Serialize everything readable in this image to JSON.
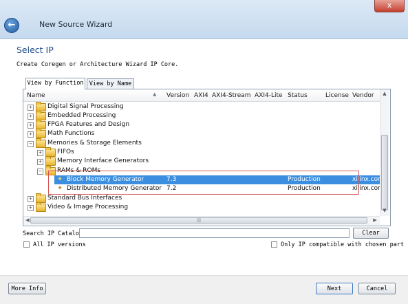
{
  "window": {
    "title": "New Source Wizard",
    "close_label": "x",
    "back_label": "←"
  },
  "page": {
    "heading": "Select IP",
    "instruction": "Create Coregen or Architecture Wizard IP Core."
  },
  "tabs": [
    {
      "label": "View by Function",
      "active": true
    },
    {
      "label": "View by Name",
      "active": false
    }
  ],
  "columns": [
    "Name",
    "Version",
    "AXI4",
    "AXI4-Stream",
    "AXI4-Lite",
    "Status",
    "License",
    "Vendor"
  ],
  "tree": [
    {
      "label": "Digital Signal Processing",
      "expander": "+"
    },
    {
      "label": "Embedded Processing",
      "expander": "+"
    },
    {
      "label": "FPGA Features and Design",
      "expander": "+"
    },
    {
      "label": "Math Functions",
      "expander": "+"
    },
    {
      "label": "Memories & Storage Elements",
      "expander": "−"
    },
    {
      "label": "FIFOs",
      "expander": "+"
    },
    {
      "label": "Memory Interface Generators",
      "expander": "+"
    },
    {
      "label": "RAMs & ROMs",
      "expander": "−"
    },
    {
      "label": "Block Memory Generator",
      "version": "7.3",
      "status": "Production",
      "vendor": "xilinx.com",
      "selected": true
    },
    {
      "label": "Distributed Memory Generator",
      "version": "7.2",
      "status": "Production",
      "vendor": "xilinx.com"
    },
    {
      "label": "Standard Bus Interfaces",
      "expander": "+"
    },
    {
      "label": "Video & Image Processing",
      "expander": "+"
    }
  ],
  "scroll": {
    "up": "▲",
    "down": "▼",
    "left": "◀",
    "right": "▶",
    "grip": "|||"
  },
  "search": {
    "label": "Search IP Catalog:",
    "value": "",
    "clear_label": "Clear"
  },
  "options": {
    "all_versions_label": "All IP versions",
    "compatible_only_label": "Only IP compatible with chosen part"
  },
  "footer": {
    "more_info_label": "More Info",
    "next_label": "Next",
    "cancel_label": "Cancel"
  },
  "colors": {
    "selection": "#3c8fe0",
    "heading": "#1f4e8c",
    "highlight_border": "#d65454"
  },
  "icons": {
    "folder": "folder-icon",
    "ip_core": "ip-core-icon",
    "back": "back-arrow-icon"
  }
}
